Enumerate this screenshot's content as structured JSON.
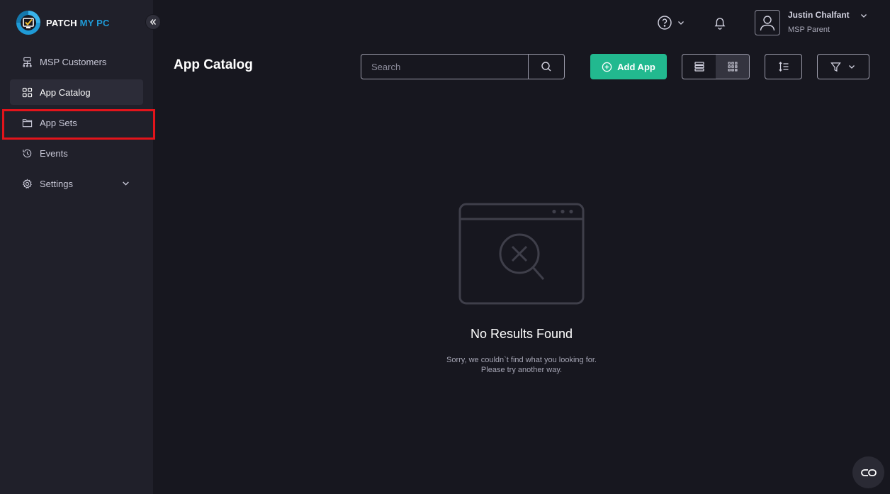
{
  "app": {
    "logo_text_1": "PATCH",
    "logo_text_2": "MY PC",
    "brand_color": "#1f9ad6",
    "accent_color": "#22b98f"
  },
  "sidebar": {
    "items": [
      {
        "label": "MSP Customers",
        "icon": "server-icon",
        "active": false
      },
      {
        "label": "App Catalog",
        "icon": "grid-icon",
        "active": true
      },
      {
        "label": "App Sets",
        "icon": "folder-icon",
        "active": false,
        "highlighted": true
      },
      {
        "label": "Events",
        "icon": "history-icon",
        "active": false
      },
      {
        "label": "Settings",
        "icon": "gear-icon",
        "active": false,
        "expandable": true
      }
    ]
  },
  "header": {
    "user_name": "Justin Chalfant",
    "user_role": "MSP Parent"
  },
  "toolbar": {
    "title": "App Catalog",
    "search_placeholder": "Search",
    "add_label": "Add App",
    "view_mode": "grid"
  },
  "empty_state": {
    "title": "No Results Found",
    "message": "Sorry, we couldn`t find what you looking for. Please try another way."
  }
}
